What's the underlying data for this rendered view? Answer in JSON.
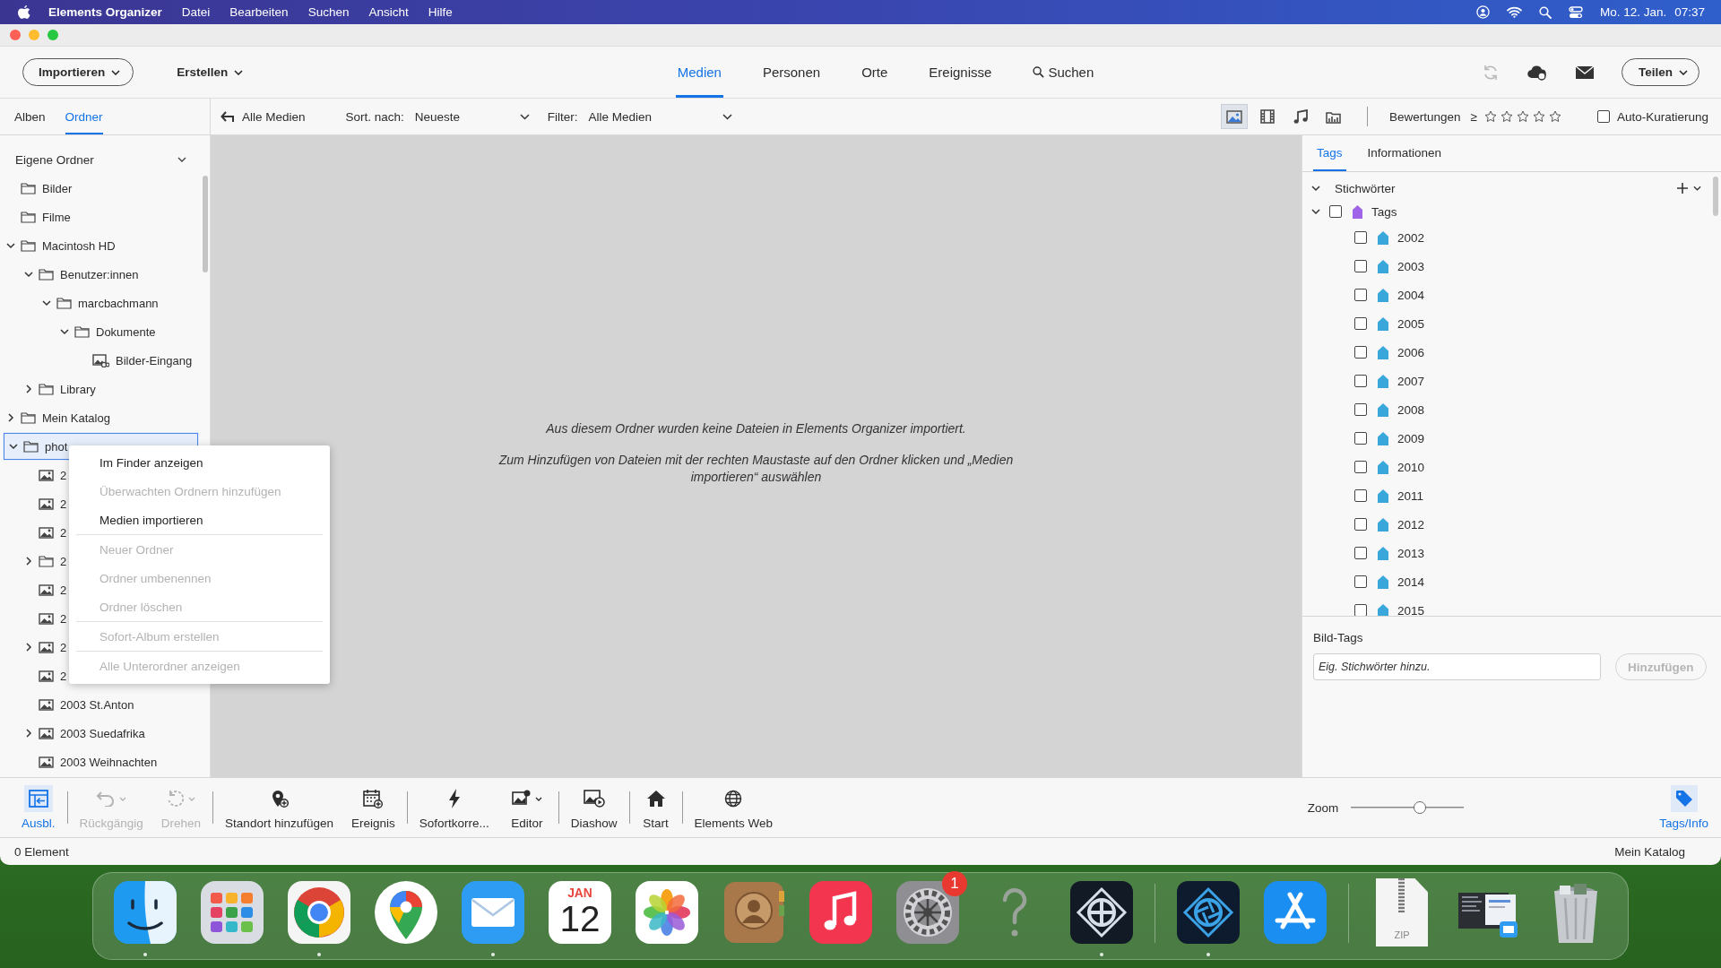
{
  "menubar": {
    "app_name": "Elements Organizer",
    "menus": [
      "Datei",
      "Bearbeiten",
      "Suchen",
      "Ansicht",
      "Hilfe"
    ],
    "date": "Mo. 12. Jan.",
    "time": "07:37"
  },
  "toolbar": {
    "import_button": "Importieren",
    "create_menu": "Erstellen",
    "nav": [
      {
        "label": "Medien",
        "selected": true
      },
      {
        "label": "Personen",
        "selected": false
      },
      {
        "label": "Orte",
        "selected": false
      },
      {
        "label": "Ereignisse",
        "selected": false
      }
    ],
    "search": "Suchen",
    "icons": [
      {
        "kind": "sync",
        "disabled": true
      },
      {
        "kind": "cloud",
        "disabled": false
      },
      {
        "kind": "mail",
        "disabled": false
      }
    ],
    "share_button": "Teilen"
  },
  "left_tabs": [
    {
      "label": "Alben",
      "selected": false
    },
    {
      "label": "Ordner",
      "selected": true
    }
  ],
  "filter_bar": {
    "back_label": "Alle Medien",
    "sort_label": "Sort. nach:",
    "sort_value": "Neueste",
    "filter_label": "Filter:",
    "filter_value": "Alle Medien",
    "media_types": [
      {
        "kind": "photo",
        "selected": true
      },
      {
        "kind": "video",
        "selected": false
      },
      {
        "kind": "audio",
        "selected": false
      },
      {
        "kind": "project",
        "selected": false
      }
    ],
    "ratings_label": "Bewertungen",
    "ratings_operator": "≥",
    "stars": 0,
    "auto_curation": {
      "label": "Auto-Kuratierung",
      "checked": false
    }
  },
  "sidebar": {
    "title": "Eigene Ordner",
    "tree": [
      {
        "label": "Bilder",
        "kind": "folder",
        "selected": false
      },
      {
        "label": "Filme",
        "kind": "folder",
        "selected": false
      },
      {
        "label": "Macintosh HD",
        "kind": "folder",
        "selected": false,
        "expanded": true,
        "children": [
          {
            "label": "Benutzer:innen",
            "kind": "folder",
            "selected": false,
            "expanded": true,
            "children": [
              {
                "label": "marcbachmann",
                "kind": "folder",
                "selected": false,
                "expanded": true,
                "children": [
                  {
                    "label": "Dokumente",
                    "kind": "folder",
                    "selected": false,
                    "expanded": true,
                    "children": [
                      {
                        "label": "Bilder-Eingang",
                        "kind": "watched",
                        "selected": false
                      }
                    ]
                  }
                ]
              }
            ]
          },
          {
            "label": "Library",
            "kind": "folder",
            "selected": false,
            "expanded": false
          }
        ]
      },
      {
        "label": "Mein Katalog",
        "kind": "folder",
        "selected": false,
        "expanded": false
      },
      {
        "label": "phot",
        "kind": "folder",
        "selected": true,
        "expanded": true,
        "children": [
          {
            "label": "2",
            "kind": "image",
            "selected": false
          },
          {
            "label": "2",
            "kind": "image",
            "selected": false
          },
          {
            "label": "2",
            "kind": "image",
            "selected": false
          },
          {
            "label": "2",
            "kind": "folder",
            "selected": false,
            "expanded": false
          },
          {
            "label": "2",
            "kind": "image",
            "selected": false
          },
          {
            "label": "2",
            "kind": "image",
            "selected": false
          },
          {
            "label": "2",
            "kind": "image",
            "selected": false,
            "expanded": false
          },
          {
            "label": "2",
            "kind": "image",
            "selected": false
          },
          {
            "label": "2003 St.Anton",
            "kind": "image",
            "selected": false
          },
          {
            "label": "2003 Suedafrika",
            "kind": "image",
            "selected": false,
            "expanded": false
          },
          {
            "label": "2003 Weihnachten",
            "kind": "image",
            "selected": false
          }
        ]
      }
    ]
  },
  "context_menu": {
    "groups": [
      [
        {
          "label": "Im Finder anzeigen",
          "disabled": false
        },
        {
          "label": "Überwachten Ordnern hinzufügen",
          "disabled": true
        },
        {
          "label": "Medien importieren",
          "disabled": false
        }
      ],
      [
        {
          "label": "Neuer Ordner",
          "disabled": true
        },
        {
          "label": "Ordner umbenennen",
          "disabled": true
        },
        {
          "label": "Ordner löschen",
          "disabled": true
        }
      ],
      [
        {
          "label": "Sofort-Album erstellen",
          "disabled": true
        }
      ],
      [
        {
          "label": "Alle Unterordner anzeigen",
          "disabled": true
        }
      ]
    ]
  },
  "media_area": {
    "messages": [
      "Aus diesem Ordner wurden keine Dateien in Elements Organizer importiert.",
      "Zum Hinzufügen von Dateien mit der rechten Maustaste auf den Ordner klicken und „Medien importieren“ auswählen"
    ]
  },
  "tags_panel": {
    "tabs": [
      {
        "label": "Tags",
        "selected": true
      },
      {
        "label": "Informationen",
        "selected": false
      }
    ],
    "keywords": {
      "label": "Stichwörter",
      "expanded": true,
      "categories": [
        {
          "label": "Tags",
          "expanded": true,
          "checked": false,
          "color": "#a064e8",
          "children": [
            {
              "label": "2002",
              "checked": false,
              "color": "#3aa7da"
            },
            {
              "label": "2003",
              "checked": false,
              "color": "#3aa7da"
            },
            {
              "label": "2004",
              "checked": false,
              "color": "#3aa7da"
            },
            {
              "label": "2005",
              "checked": false,
              "color": "#3aa7da"
            },
            {
              "label": "2006",
              "checked": false,
              "color": "#3aa7da"
            },
            {
              "label": "2007",
              "checked": false,
              "color": "#3aa7da"
            },
            {
              "label": "2008",
              "checked": false,
              "color": "#3aa7da"
            },
            {
              "label": "2009",
              "checked": false,
              "color": "#3aa7da"
            },
            {
              "label": "2010",
              "checked": false,
              "color": "#3aa7da"
            },
            {
              "label": "2011",
              "checked": false,
              "color": "#3aa7da"
            },
            {
              "label": "2012",
              "checked": false,
              "color": "#3aa7da"
            },
            {
              "label": "2013",
              "checked": false,
              "color": "#3aa7da"
            },
            {
              "label": "2014",
              "checked": false,
              "color": "#3aa7da"
            },
            {
              "label": "2015",
              "checked": false,
              "color": "#3aa7da"
            }
          ]
        }
      ]
    },
    "image_tags": {
      "label": "Bild-Tags",
      "placeholder": "Eig. Stichwörter hinzu.",
      "button": {
        "label": "Hinzufügen",
        "disabled": true
      }
    }
  },
  "bottom_bar": {
    "groups": [
      [
        {
          "label": "Ausbl.",
          "kind": "panel",
          "selected": true,
          "disabled": false,
          "dropdown": false
        }
      ],
      [
        {
          "label": "Rückgängig",
          "kind": "undo",
          "selected": false,
          "disabled": true,
          "dropdown": true
        },
        {
          "label": "Drehen",
          "kind": "rotate",
          "selected": false,
          "disabled": true,
          "dropdown": true
        }
      ],
      [
        {
          "label": "Standort hinzufügen",
          "kind": "pin",
          "selected": false,
          "disabled": false,
          "dropdown": false
        },
        {
          "label": "Ereignis",
          "kind": "event",
          "selected": false,
          "disabled": false,
          "dropdown": false
        }
      ],
      [
        {
          "label": "Sofortkorre...",
          "kind": "bolt",
          "selected": false,
          "disabled": false,
          "dropdown": false
        },
        {
          "label": "Editor",
          "kind": "editor",
          "selected": false,
          "disabled": false,
          "dropdown": true
        }
      ],
      [
        {
          "label": "Diashow",
          "kind": "slideshow",
          "selected": false,
          "disabled": false,
          "dropdown": false
        }
      ],
      [
        {
          "label": "Start",
          "kind": "home",
          "selected": false,
          "disabled": false,
          "dropdown": false
        }
      ],
      [
        {
          "label": "Elements Web",
          "kind": "globe",
          "selected": false,
          "disabled": false,
          "dropdown": false
        }
      ]
    ],
    "zoom": {
      "label": "Zoom",
      "level": 0.61
    },
    "panel_toggle": {
      "label": "Tags/Info",
      "selected": true
    }
  },
  "status_bar": {
    "count": "0 Element",
    "catalog": "Mein Katalog"
  },
  "dock": {
    "items": [
      {
        "kind": "finder",
        "running": true
      },
      {
        "kind": "launchpad",
        "running": false
      },
      {
        "kind": "chrome",
        "running": true
      },
      {
        "kind": "maps",
        "running": false
      },
      {
        "kind": "mail",
        "running": true
      },
      {
        "kind": "calendar",
        "month": "JAN",
        "day": "12",
        "running": false
      },
      {
        "kind": "photos",
        "running": false
      },
      {
        "kind": "contacts",
        "running": false
      },
      {
        "kind": "music",
        "running": false
      },
      {
        "kind": "settings",
        "badge": "1",
        "running": false
      },
      {
        "kind": "unknown",
        "running": false
      },
      {
        "kind": "organizer",
        "running": true
      },
      {
        "kind": "separator"
      },
      {
        "kind": "editor",
        "running": true
      },
      {
        "kind": "appstore",
        "running": false
      },
      {
        "kind": "separator"
      },
      {
        "kind": "zip",
        "label": "ZIP",
        "running": false
      },
      {
        "kind": "stack",
        "running": false
      },
      {
        "kind": "trash",
        "running": false
      }
    ]
  }
}
